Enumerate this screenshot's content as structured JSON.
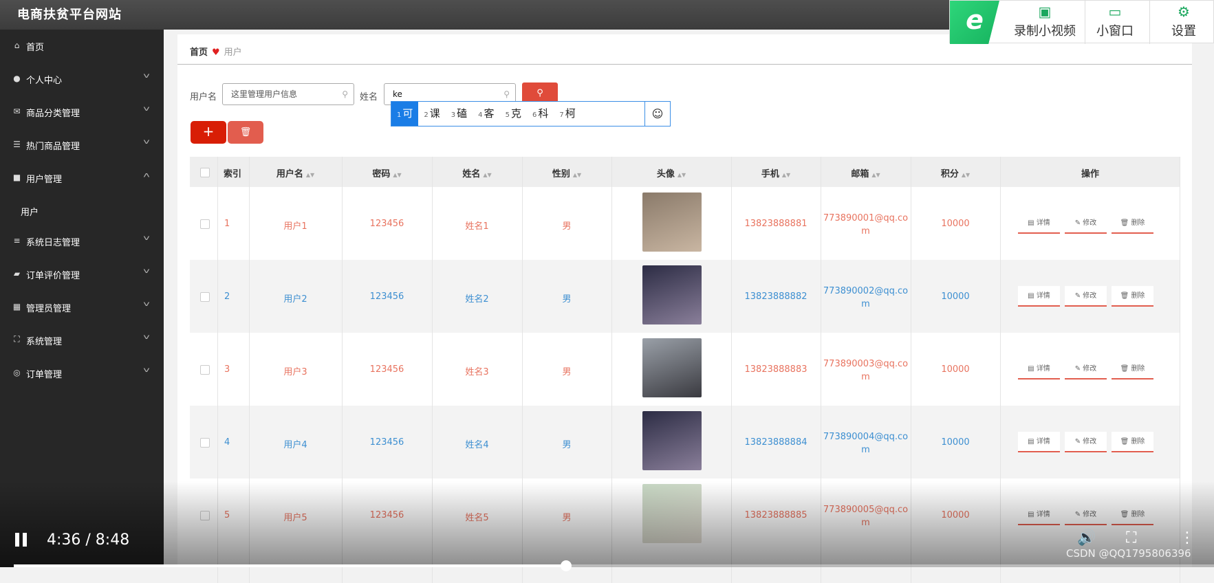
{
  "header": {
    "title": "电商扶贫平台网站"
  },
  "sidebar": {
    "items": [
      {
        "label": "首页",
        "icon": "home-icon"
      },
      {
        "label": "个人中心",
        "icon": "user-icon"
      },
      {
        "label": "商品分类管理",
        "icon": "mail-icon"
      },
      {
        "label": "热门商品管理",
        "icon": "list-icon"
      },
      {
        "label": "用户管理",
        "icon": "chat-icon"
      },
      {
        "label": "系统日志管理",
        "icon": "menu-icon"
      },
      {
        "label": "订单评价管理",
        "icon": "ticket-icon"
      },
      {
        "label": "管理员管理",
        "icon": "grid-icon"
      },
      {
        "label": "系统管理",
        "icon": "frame-icon"
      },
      {
        "label": "订单管理",
        "icon": "compass-icon"
      }
    ],
    "sub_item": "用户"
  },
  "breadcrumb": {
    "home": "首页",
    "current": "用户"
  },
  "search": {
    "username_label": "用户名",
    "username_value": "这里管理用户信息",
    "name_label": "姓名",
    "name_value": "ke"
  },
  "ime": {
    "candidates": [
      {
        "n": "1",
        "c": "可"
      },
      {
        "n": "2",
        "c": "课"
      },
      {
        "n": "3",
        "c": "磕"
      },
      {
        "n": "4",
        "c": "客"
      },
      {
        "n": "5",
        "c": "克"
      },
      {
        "n": "6",
        "c": "科"
      },
      {
        "n": "7",
        "c": "柯"
      }
    ]
  },
  "table": {
    "headers": [
      "索引",
      "用户名",
      "密码",
      "姓名",
      "性别",
      "头像",
      "手机",
      "邮箱",
      "积分",
      "操作"
    ],
    "rows": [
      {
        "idx": "1",
        "user": "用户1",
        "pwd": "123456",
        "name": "姓名1",
        "sex": "男",
        "phone": "13823888881",
        "email1": "773890001@qq.co",
        "email2": "m",
        "score": "10000"
      },
      {
        "idx": "2",
        "user": "用户2",
        "pwd": "123456",
        "name": "姓名2",
        "sex": "男",
        "phone": "13823888882",
        "email1": "773890002@qq.co",
        "email2": "m",
        "score": "10000"
      },
      {
        "idx": "3",
        "user": "用户3",
        "pwd": "123456",
        "name": "姓名3",
        "sex": "男",
        "phone": "13823888883",
        "email1": "773890003@qq.co",
        "email2": "m",
        "score": "10000"
      },
      {
        "idx": "4",
        "user": "用户4",
        "pwd": "123456",
        "name": "姓名4",
        "sex": "男",
        "phone": "13823888884",
        "email1": "773890004@qq.co",
        "email2": "m",
        "score": "10000"
      },
      {
        "idx": "5",
        "user": "用户5",
        "pwd": "123456",
        "name": "姓名5",
        "sex": "男",
        "phone": "13823888885",
        "email1": "773890005@qq.co",
        "email2": "m",
        "score": "10000"
      }
    ],
    "actions": {
      "detail": "详情",
      "edit": "修改",
      "delete": "删除"
    }
  },
  "colors": {
    "row_odd": "#e8735f",
    "row_even": "#3d8fd1",
    "accent": "#d81e06"
  },
  "video": {
    "time": "4:36 / 8:48",
    "progress": 0.46
  },
  "recorder": {
    "record": "录制小视频",
    "mini": "小窗口",
    "settings": "设置"
  },
  "watermark": "CSDN @QQ1795806396"
}
